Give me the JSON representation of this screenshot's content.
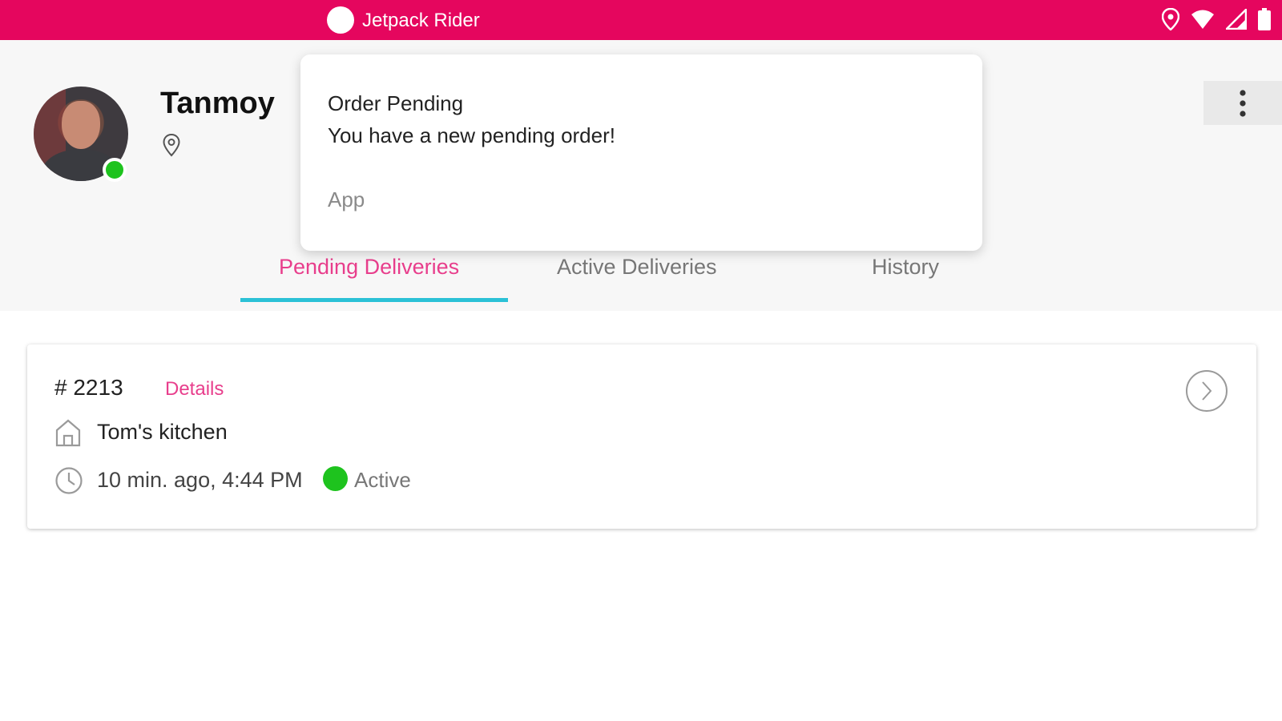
{
  "status_bar": {
    "app_title": "Jetpack Rider",
    "accent_color": "#e5065e",
    "icons": [
      "location-icon",
      "wifi-icon",
      "signal-icon",
      "battery-icon"
    ]
  },
  "profile": {
    "name": "Tanmoy",
    "status": "online",
    "status_color": "#1ec31e"
  },
  "notification": {
    "title": "Order Pending",
    "body": "You have a new pending order!",
    "app": "App"
  },
  "tabs": [
    {
      "label": "Pending Deliveries",
      "active": true
    },
    {
      "label": "Active Deliveries",
      "active": false
    },
    {
      "label": "History",
      "active": false
    }
  ],
  "orders": [
    {
      "number": "# 2213",
      "details_label": "Details",
      "restaurant": "Tom's kitchen",
      "time": "10 min. ago, 4:44 PM",
      "status": "Active",
      "status_color": "#1ec31e"
    }
  ],
  "colors": {
    "accent_pink": "#e83e8c",
    "tab_indicator": "#2bc1d6"
  }
}
